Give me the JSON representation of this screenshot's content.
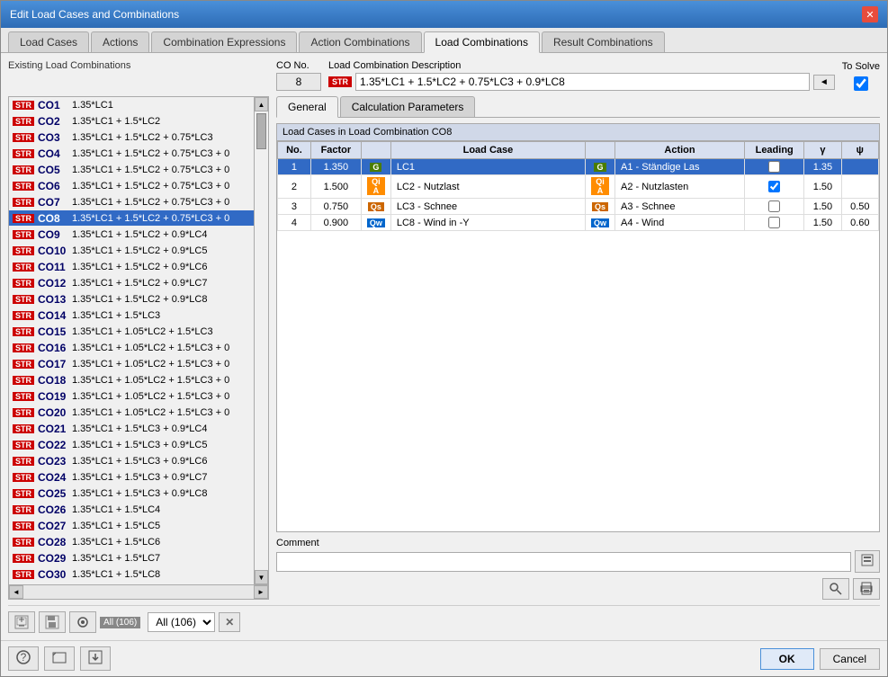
{
  "window": {
    "title": "Edit Load Cases and Combinations"
  },
  "tabs": [
    {
      "label": "Load Cases",
      "active": false
    },
    {
      "label": "Actions",
      "active": false
    },
    {
      "label": "Combination Expressions",
      "active": false
    },
    {
      "label": "Action Combinations",
      "active": false
    },
    {
      "label": "Load Combinations",
      "active": true
    },
    {
      "label": "Result Combinations",
      "active": false
    }
  ],
  "left_panel": {
    "label": "Existing Load Combinations",
    "items": [
      {
        "badge": "STR",
        "name": "CO1",
        "desc": "1.35*LC1"
      },
      {
        "badge": "STR",
        "name": "CO2",
        "desc": "1.35*LC1 + 1.5*LC2"
      },
      {
        "badge": "STR",
        "name": "CO3",
        "desc": "1.35*LC1 + 1.5*LC2 + 0.75*LC3"
      },
      {
        "badge": "STR",
        "name": "CO4",
        "desc": "1.35*LC1 + 1.5*LC2 + 0.75*LC3 + 0"
      },
      {
        "badge": "STR",
        "name": "CO5",
        "desc": "1.35*LC1 + 1.5*LC2 + 0.75*LC3 + 0"
      },
      {
        "badge": "STR",
        "name": "CO6",
        "desc": "1.35*LC1 + 1.5*LC2 + 0.75*LC3 + 0"
      },
      {
        "badge": "STR",
        "name": "CO7",
        "desc": "1.35*LC1 + 1.5*LC2 + 0.75*LC3 + 0"
      },
      {
        "badge": "STR",
        "name": "CO8",
        "desc": "1.35*LC1 + 1.5*LC2 + 0.75*LC3 + 0",
        "selected": true
      },
      {
        "badge": "STR",
        "name": "CO9",
        "desc": "1.35*LC1 + 1.5*LC2 + 0.9*LC4"
      },
      {
        "badge": "STR",
        "name": "CO10",
        "desc": "1.35*LC1 + 1.5*LC2 + 0.9*LC5"
      },
      {
        "badge": "STR",
        "name": "CO11",
        "desc": "1.35*LC1 + 1.5*LC2 + 0.9*LC6"
      },
      {
        "badge": "STR",
        "name": "CO12",
        "desc": "1.35*LC1 + 1.5*LC2 + 0.9*LC7"
      },
      {
        "badge": "STR",
        "name": "CO13",
        "desc": "1.35*LC1 + 1.5*LC2 + 0.9*LC8"
      },
      {
        "badge": "STR",
        "name": "CO14",
        "desc": "1.35*LC1 + 1.5*LC3"
      },
      {
        "badge": "STR",
        "name": "CO15",
        "desc": "1.35*LC1 + 1.05*LC2 + 1.5*LC3"
      },
      {
        "badge": "STR",
        "name": "CO16",
        "desc": "1.35*LC1 + 1.05*LC2 + 1.5*LC3 + 0"
      },
      {
        "badge": "STR",
        "name": "CO17",
        "desc": "1.35*LC1 + 1.05*LC2 + 1.5*LC3 + 0"
      },
      {
        "badge": "STR",
        "name": "CO18",
        "desc": "1.35*LC1 + 1.05*LC2 + 1.5*LC3 + 0"
      },
      {
        "badge": "STR",
        "name": "CO19",
        "desc": "1.35*LC1 + 1.05*LC2 + 1.5*LC3 + 0"
      },
      {
        "badge": "STR",
        "name": "CO20",
        "desc": "1.35*LC1 + 1.05*LC2 + 1.5*LC3 + 0"
      },
      {
        "badge": "STR",
        "name": "CO21",
        "desc": "1.35*LC1 + 1.5*LC3 + 0.9*LC4"
      },
      {
        "badge": "STR",
        "name": "CO22",
        "desc": "1.35*LC1 + 1.5*LC3 + 0.9*LC5"
      },
      {
        "badge": "STR",
        "name": "CO23",
        "desc": "1.35*LC1 + 1.5*LC3 + 0.9*LC6"
      },
      {
        "badge": "STR",
        "name": "CO24",
        "desc": "1.35*LC1 + 1.5*LC3 + 0.9*LC7"
      },
      {
        "badge": "STR",
        "name": "CO25",
        "desc": "1.35*LC1 + 1.5*LC3 + 0.9*LC8"
      },
      {
        "badge": "STR",
        "name": "CO26",
        "desc": "1.35*LC1 + 1.5*LC4"
      },
      {
        "badge": "STR",
        "name": "CO27",
        "desc": "1.35*LC1 + 1.5*LC5"
      },
      {
        "badge": "STR",
        "name": "CO28",
        "desc": "1.35*LC1 + 1.5*LC6"
      },
      {
        "badge": "STR",
        "name": "CO29",
        "desc": "1.35*LC1 + 1.5*LC7"
      },
      {
        "badge": "STR",
        "name": "CO30",
        "desc": "1.35*LC1 + 1.5*LC8"
      }
    ]
  },
  "co_no": {
    "label": "CO No.",
    "value": "8"
  },
  "desc_section": {
    "label": "Load Combination Description",
    "badge": "STR",
    "value": "1.35*LC1 + 1.5*LC2 + 0.75*LC3 + 0.9*LC8"
  },
  "to_solve": {
    "label": "To Solve",
    "checked": true
  },
  "inner_tabs": [
    {
      "label": "General",
      "active": true
    },
    {
      "label": "Calculation Parameters",
      "active": false
    }
  ],
  "co_table": {
    "title": "Load Cases in Load Combination CO8",
    "headers": [
      "No.",
      "Factor",
      "",
      "Load Case",
      "",
      "Action",
      "Leading",
      "γ",
      "ψ"
    ],
    "rows": [
      {
        "no": "1",
        "factor": "1.350",
        "lc_badge": "G",
        "lc_badge_class": "g",
        "lc_name": "LC1",
        "action_badge": "G",
        "action_badge_class": "g",
        "action": "A1 - Ständige Las",
        "leading": false,
        "gamma": "1.35",
        "psi": "",
        "selected": true
      },
      {
        "no": "2",
        "factor": "1.500",
        "lc_badge": "Qi A",
        "lc_badge_class": "qi",
        "lc_name": "LC2 - Nutzlast",
        "action_badge": "Qi A",
        "action_badge_class": "qi",
        "action": "A2 - Nutzlasten",
        "leading": true,
        "gamma": "1.50",
        "psi": "",
        "selected": false
      },
      {
        "no": "3",
        "factor": "0.750",
        "lc_badge": "Qs",
        "lc_badge_class": "qs",
        "lc_name": "LC3 - Schnee",
        "action_badge": "Qs",
        "action_badge_class": "qs",
        "action": "A3 - Schnee",
        "leading": false,
        "gamma": "1.50",
        "psi": "0.50",
        "selected": false
      },
      {
        "no": "4",
        "factor": "0.900",
        "lc_badge": "Qw",
        "lc_badge_class": "qw",
        "lc_name": "LC8 - Wind in -Y",
        "action_badge": "Qw",
        "action_badge_class": "qw",
        "action": "A4 - Wind",
        "leading": false,
        "gamma": "1.50",
        "psi": "0.60",
        "selected": false
      }
    ]
  },
  "comment": {
    "label": "Comment",
    "placeholder": ""
  },
  "bottom_bar": {
    "all_label": "All (106)",
    "clear_btn": "✕"
  },
  "footer": {
    "ok_label": "OK",
    "cancel_label": "Cancel"
  }
}
